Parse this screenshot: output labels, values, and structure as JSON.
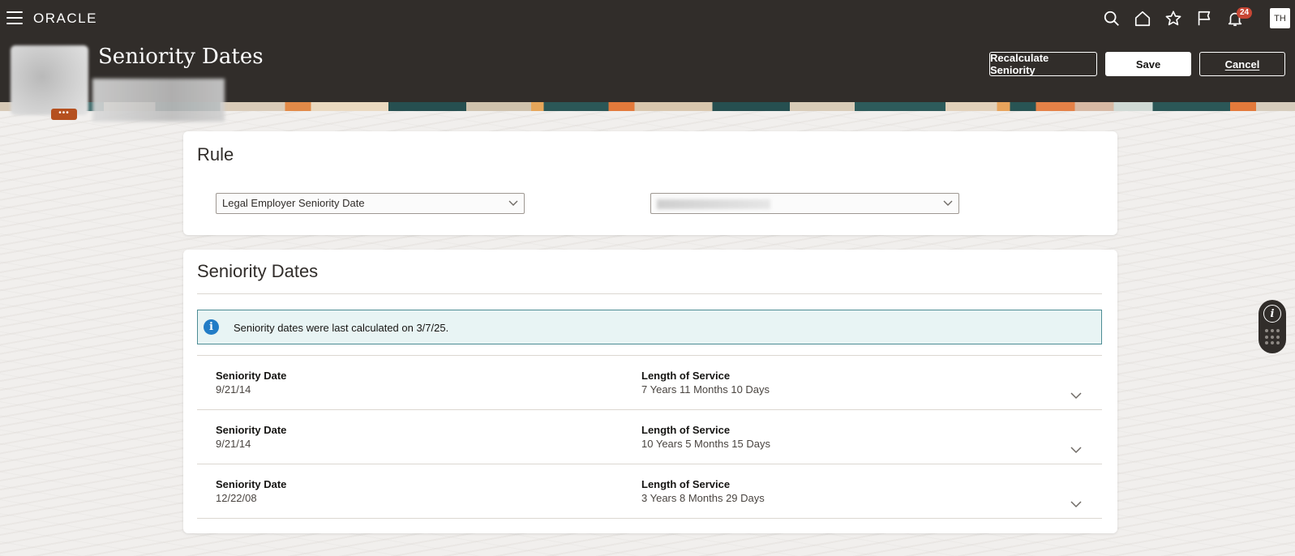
{
  "header": {
    "logo": "ORACLE",
    "page_title": "Seniority Dates",
    "notifications_count": "24",
    "user_initials": "TH",
    "person_more_label": "•••",
    "actions": {
      "recalculate": "Recalculate Seniority",
      "save": "Save",
      "cancel": "Cancel"
    },
    "icons": [
      "hamburger-menu-icon",
      "search-icon",
      "home-icon",
      "star-icon",
      "flag-icon",
      "bell-icon"
    ]
  },
  "rule_card": {
    "title": "Rule",
    "selected_rule": "Legal Employer Seniority Date"
  },
  "dates_card": {
    "title": "Seniority Dates",
    "info_message": "Seniority dates were last calculated on 3/7/25.",
    "rows": [
      {
        "date_label": "Seniority Date",
        "date_value": "9/21/14",
        "service_label": "Length of Service",
        "service_value": "7 Years 11 Months 10 Days"
      },
      {
        "date_label": "Seniority Date",
        "date_value": "9/21/14",
        "service_label": "Length of Service",
        "service_value": "10 Years 5 Months 15 Days"
      },
      {
        "date_label": "Seniority Date",
        "date_value": "12/22/08",
        "service_label": "Length of Service",
        "service_value": "3 Years 8 Months 29 Days"
      }
    ]
  },
  "colors": {
    "header_bg": "#312d2a",
    "badge": "#c74634",
    "info_bg": "#e8f4f4",
    "info_border": "#4d8d95",
    "info_icon": "#227cc6"
  }
}
